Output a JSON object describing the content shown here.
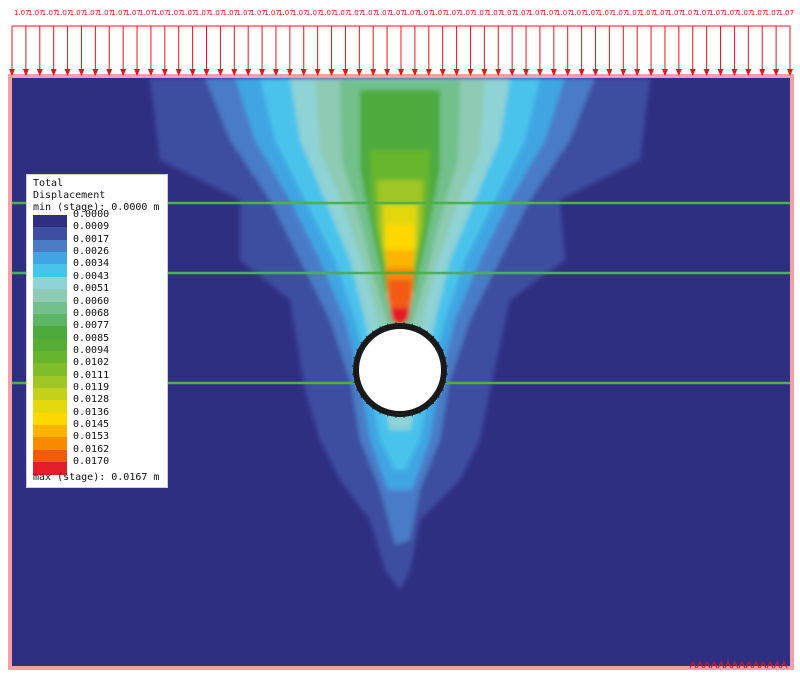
{
  "load": {
    "label": "1.07",
    "count": 57
  },
  "legend": {
    "title_line1": "Total",
    "title_line2": "Displacement",
    "min_text": "min (stage): 0.0000 m",
    "max_text": "max (stage): 0.0167 m",
    "levels": [
      {
        "value": "0.0000",
        "color": "#2f2f82"
      },
      {
        "value": "0.0009",
        "color": "#3e4ea0"
      },
      {
        "value": "0.0017",
        "color": "#4a7cc6"
      },
      {
        "value": "0.0026",
        "color": "#3fa6e3"
      },
      {
        "value": "0.0034",
        "color": "#48c3ec"
      },
      {
        "value": "0.0043",
        "color": "#8fd3d6"
      },
      {
        "value": "0.0051",
        "color": "#8dcbb2"
      },
      {
        "value": "0.0060",
        "color": "#72c08c"
      },
      {
        "value": "0.0068",
        "color": "#5db565"
      },
      {
        "value": "0.0077",
        "color": "#4dab3e"
      },
      {
        "value": "0.0085",
        "color": "#55ad33"
      },
      {
        "value": "0.0094",
        "color": "#67b52e"
      },
      {
        "value": "0.0102",
        "color": "#80bd2b"
      },
      {
        "value": "0.0111",
        "color": "#9fc627"
      },
      {
        "value": "0.0119",
        "color": "#c2d11c"
      },
      {
        "value": "0.0128",
        "color": "#e4d80e"
      },
      {
        "value": "0.0136",
        "color": "#ffd800"
      },
      {
        "value": "0.0145",
        "color": "#fcb400"
      },
      {
        "value": "0.0153",
        "color": "#f88a00"
      },
      {
        "value": "0.0162",
        "color": "#f25a12"
      },
      {
        "value": "0.0170",
        "color": "#e41e26"
      }
    ]
  },
  "colors": {
    "background": "#2f2f82",
    "load_arrow": "#e8141c",
    "layer_line": "#4db04a",
    "tunnel_lining": "#1a1a1a",
    "tunnel_anchor": "#5bc8ea",
    "boundary": "#f2a0a8"
  }
}
